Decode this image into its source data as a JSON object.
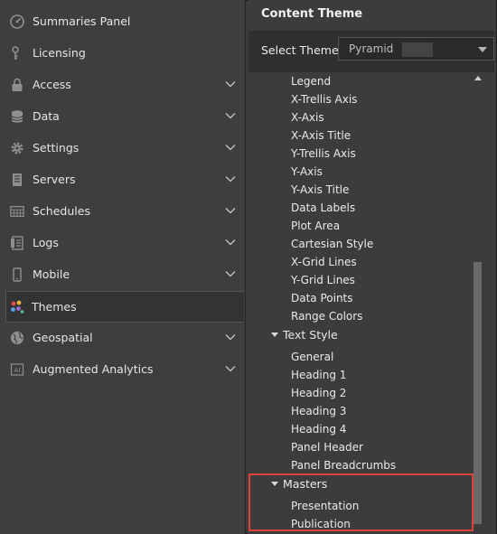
{
  "sidebar": {
    "items": [
      {
        "label": "Summaries Panel",
        "icon": "gauge-icon",
        "expandable": false
      },
      {
        "label": "Licensing",
        "icon": "key-icon",
        "expandable": false
      },
      {
        "label": "Access",
        "icon": "lock-icon",
        "expandable": true
      },
      {
        "label": "Data",
        "icon": "database-icon",
        "expandable": true
      },
      {
        "label": "Settings",
        "icon": "gear-icon",
        "expandable": true
      },
      {
        "label": "Servers",
        "icon": "server-icon",
        "expandable": true
      },
      {
        "label": "Schedules",
        "icon": "calendar-icon",
        "expandable": true
      },
      {
        "label": "Logs",
        "icon": "logs-icon",
        "expandable": true
      },
      {
        "label": "Mobile",
        "icon": "mobile-icon",
        "expandable": true
      },
      {
        "label": "Themes",
        "icon": "palette-icon",
        "expandable": false,
        "active": true
      },
      {
        "label": "Geospatial",
        "icon": "globe-icon",
        "expandable": true
      },
      {
        "label": "Augmented Analytics",
        "icon": "ai-icon",
        "expandable": true
      }
    ]
  },
  "panel": {
    "title": "Content Theme",
    "select_theme_label": "Select Theme",
    "selected_theme": "Pyramid",
    "chart_items": [
      "Legend",
      "X-Trellis Axis",
      "X-Axis",
      "X-Axis Title",
      "Y-Trellis Axis",
      "Y-Axis",
      "Y-Axis Title",
      "Data Labels",
      "Plot Area",
      "Cartesian Style",
      "X-Grid Lines",
      "Y-Grid Lines",
      "Data Points",
      "Range Colors"
    ],
    "text_style_label": "Text Style",
    "text_style_items": [
      "General",
      "Heading 1",
      "Heading 2",
      "Heading 3",
      "Heading 4",
      "Panel Header",
      "Panel Breadcrumbs"
    ],
    "masters_label": "Masters",
    "masters_items": [
      "Presentation",
      "Publication"
    ]
  },
  "colors": {
    "highlight": "#d9443d",
    "sidebar_bg": "#3e3e3e",
    "panel_bg": "#3c3c3c"
  }
}
